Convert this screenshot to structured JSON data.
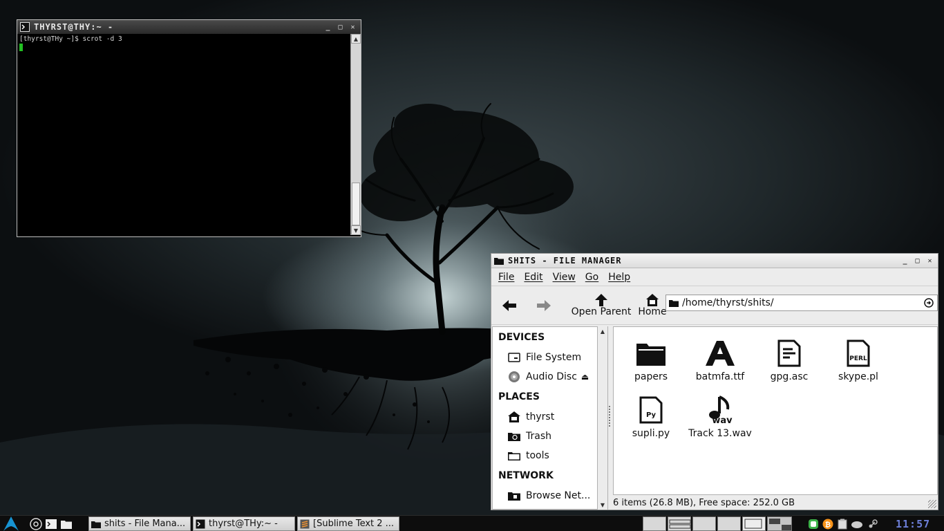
{
  "terminal": {
    "title": "THYRST@THY:~ -",
    "prompt_line": "[thyrst@THy ~]$ scrot -d 3"
  },
  "file_manager": {
    "title": "SHITS - FILE MANAGER",
    "menu": [
      "File",
      "Edit",
      "View",
      "Go",
      "Help"
    ],
    "toolbar": {
      "back_icon": "back-arrow-icon",
      "forward_icon": "forward-arrow-icon",
      "open_parent_label": "Open Parent",
      "home_label": "Home"
    },
    "location": "/home/thyrst/shits/",
    "sidebar": {
      "devices_header": "DEVICES",
      "devices": [
        {
          "label": "File System",
          "icon": "drive-icon"
        },
        {
          "label": "Audio Disc",
          "icon": "disc-icon"
        }
      ],
      "places_header": "PLACES",
      "places": [
        {
          "label": "thyrst",
          "icon": "home-icon"
        },
        {
          "label": "Trash",
          "icon": "trash-icon"
        },
        {
          "label": "tools",
          "icon": "folder-icon"
        }
      ],
      "network_header": "NETWORK",
      "network": [
        {
          "label": "Browse Net...",
          "icon": "network-icon"
        }
      ]
    },
    "files": [
      {
        "name": "papers",
        "icon": "folder-icon"
      },
      {
        "name": "batmfa.ttf",
        "icon": "font-icon"
      },
      {
        "name": "gpg.asc",
        "icon": "text-file-icon"
      },
      {
        "name": "skype.pl",
        "icon": "perl-file-icon",
        "badge": "PERL"
      },
      {
        "name": "supli.py",
        "icon": "python-file-icon",
        "badge": "Py"
      },
      {
        "name": "Track 13.wav",
        "icon": "audio-file-icon",
        "badge": "wav"
      }
    ],
    "status": "6 items (26.8 MB), Free space: 252.0 GB"
  },
  "taskbar": {
    "tasks": [
      {
        "label": "shits - File Mana...",
        "icon": "folder-icon"
      },
      {
        "label": "thyrst@THy:~ -",
        "icon": "terminal-icon"
      },
      {
        "label": "[Sublime Text 2 ...",
        "icon": "sublime-icon"
      }
    ],
    "clock": "11:57"
  },
  "colors": {
    "clock": "#6d7fd8",
    "terminal_cursor": "#22c022",
    "arch_blue": "#1793d1"
  }
}
